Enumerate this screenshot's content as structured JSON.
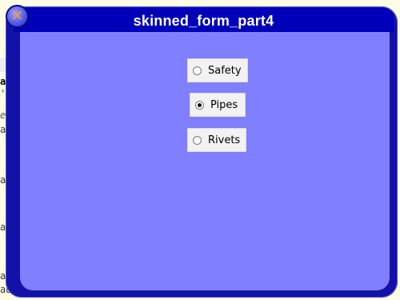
{
  "form": {
    "title": "skinned_form_part4",
    "close_glyph": "✕",
    "radios": [
      {
        "label": "Safety",
        "checked": false
      },
      {
        "label": "Pipes",
        "checked": true
      },
      {
        "label": "Rivets",
        "checked": false
      }
    ]
  },
  "background_code": {
    "lines": [
      "ak",
      "' '",
      "el",
      "ad",
      "ad",
      "ad",
      "ad",
      "ad"
    ]
  },
  "colors": {
    "frame": "#1212a8",
    "title_bar": "#0000b8",
    "client": "#7f7fff",
    "close_x": "#ff9a24"
  }
}
